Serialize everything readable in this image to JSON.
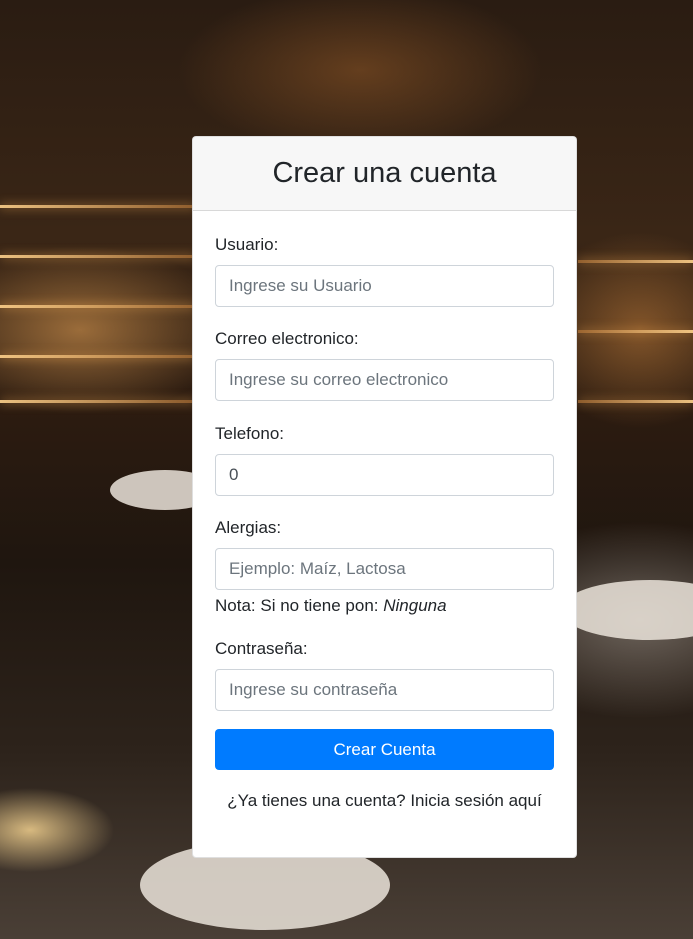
{
  "form": {
    "title": "Crear una cuenta",
    "username": {
      "label": "Usuario:",
      "placeholder": "Ingrese su Usuario",
      "value": ""
    },
    "email": {
      "label": "Correo electronico:",
      "placeholder": "Ingrese su correo electronico",
      "value": ""
    },
    "phone": {
      "label": "Telefono:",
      "placeholder": "",
      "value": "0"
    },
    "allergies": {
      "label": "Alergias:",
      "placeholder": "Ejemplo: Maíz, Lactosa",
      "value": "",
      "note_prefix": "Nota: Si no tiene pon: ",
      "note_emphasis": "Ninguna"
    },
    "password": {
      "label": "Contraseña:",
      "placeholder": "Ingrese su contraseña",
      "value": ""
    },
    "submit_label": "Crear Cuenta",
    "login_link": "¿Ya tienes una cuenta? Inicia sesión aquí"
  },
  "colors": {
    "primary_button": "#007bff",
    "header_bg": "#f7f7f7"
  }
}
